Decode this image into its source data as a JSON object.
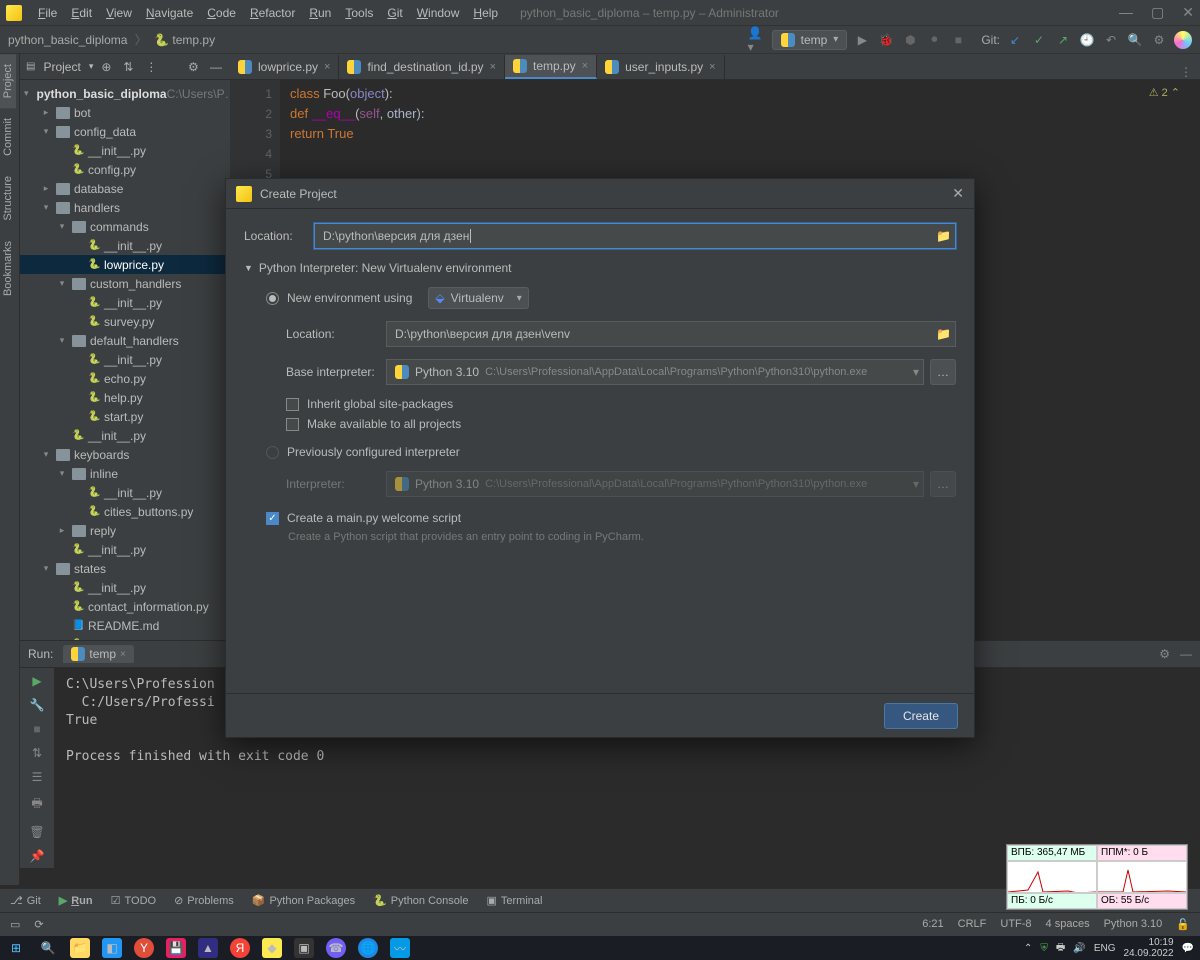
{
  "window": {
    "title": "python_basic_diploma – temp.py – Administrator",
    "menus": [
      "File",
      "Edit",
      "View",
      "Navigate",
      "Code",
      "Refactor",
      "Run",
      "Tools",
      "Git",
      "Window",
      "Help"
    ]
  },
  "breadcrumb": {
    "project": "python_basic_diploma",
    "file": "temp.py"
  },
  "run_config": {
    "name": "temp"
  },
  "toolbar": {
    "git_label": "Git:"
  },
  "left_tabs": [
    "Project",
    "Commit",
    "Structure",
    "Bookmarks"
  ],
  "project_panel": {
    "title": "Project"
  },
  "tree": {
    "root": "python_basic_diploma",
    "root_path": "C:\\Users\\P…",
    "nodes": [
      {
        "indent": 1,
        "type": "dir",
        "name": "bot",
        "arrow": ">"
      },
      {
        "indent": 1,
        "type": "dir",
        "name": "config_data",
        "arrow": "v"
      },
      {
        "indent": 2,
        "type": "py",
        "name": "__init__.py"
      },
      {
        "indent": 2,
        "type": "py",
        "name": "config.py"
      },
      {
        "indent": 1,
        "type": "dir",
        "name": "database",
        "arrow": ">"
      },
      {
        "indent": 1,
        "type": "dir",
        "name": "handlers",
        "arrow": "v"
      },
      {
        "indent": 2,
        "type": "dir",
        "name": "commands",
        "arrow": "v"
      },
      {
        "indent": 3,
        "type": "py",
        "name": "__init__.py"
      },
      {
        "indent": 3,
        "type": "py",
        "name": "lowprice.py",
        "selected": true
      },
      {
        "indent": 2,
        "type": "dir",
        "name": "custom_handlers",
        "arrow": "v"
      },
      {
        "indent": 3,
        "type": "py",
        "name": "__init__.py"
      },
      {
        "indent": 3,
        "type": "py",
        "name": "survey.py"
      },
      {
        "indent": 2,
        "type": "dir",
        "name": "default_handlers",
        "arrow": "v"
      },
      {
        "indent": 3,
        "type": "py",
        "name": "__init__.py"
      },
      {
        "indent": 3,
        "type": "py",
        "name": "echo.py"
      },
      {
        "indent": 3,
        "type": "py",
        "name": "help.py"
      },
      {
        "indent": 3,
        "type": "py",
        "name": "start.py"
      },
      {
        "indent": 2,
        "type": "py",
        "name": "__init__.py"
      },
      {
        "indent": 1,
        "type": "dir",
        "name": "keyboards",
        "arrow": "v"
      },
      {
        "indent": 2,
        "type": "dir",
        "name": "inline",
        "arrow": "v"
      },
      {
        "indent": 3,
        "type": "py",
        "name": "__init__.py"
      },
      {
        "indent": 3,
        "type": "py",
        "name": "cities_buttons.py"
      },
      {
        "indent": 2,
        "type": "dir",
        "name": "reply",
        "arrow": ">"
      },
      {
        "indent": 2,
        "type": "py",
        "name": "__init__.py"
      },
      {
        "indent": 1,
        "type": "dir",
        "name": "states",
        "arrow": "v"
      },
      {
        "indent": 2,
        "type": "py",
        "name": "__init__.py"
      },
      {
        "indent": 2,
        "type": "py",
        "name": "contact_information.py"
      },
      {
        "indent": 2,
        "type": "md",
        "name": "README.md"
      },
      {
        "indent": 2,
        "type": "py",
        "name": "user_inputs.py"
      }
    ]
  },
  "editor_tabs": [
    {
      "name": "lowprice.py"
    },
    {
      "name": "find_destination_id.py"
    },
    {
      "name": "temp.py",
      "active": true
    },
    {
      "name": "user_inputs.py"
    }
  ],
  "editor": {
    "lines": [
      "1",
      "2",
      "3",
      "4",
      "5"
    ],
    "problem_badge": "2 ⌃"
  },
  "code": {
    "l1a": "class ",
    "l1b": "Foo",
    "l1c": "(",
    "l1d": "object",
    "l1e": "):",
    "l2a": "    def ",
    "l2b": "__eq__",
    "l2c": "(",
    "l2d": "self",
    "l2e": ", other):",
    "l3a": "        return ",
    "l3b": "True"
  },
  "run_panel": {
    "title": "Run:",
    "tab": "temp",
    "output": "C:\\Users\\Profession\n  C:/Users/Professi\nTrue\n\nProcess finished with exit code 0"
  },
  "bottom_tabs": [
    "Git",
    "Run",
    "TODO",
    "Problems",
    "Python Packages",
    "Python Console",
    "Terminal"
  ],
  "status": {
    "pos": "6:21",
    "eol": "CRLF",
    "enc": "UTF-8",
    "indent": "4 spaces",
    "interp": "Python 3.10"
  },
  "dialog": {
    "title": "Create Project",
    "loc_label": "Location:",
    "loc_value": "D:\\python\\версия для дзен",
    "interp_section": "Python Interpreter: New Virtualenv environment",
    "new_env_label": "New environment using",
    "env_type": "Virtualenv",
    "venv_loc_label": "Location:",
    "venv_loc_value": "D:\\python\\версия для дзен\\venv",
    "base_label": "Base interpreter:",
    "base_value": "Python 3.10",
    "base_path": "C:\\Users\\Professional\\AppData\\Local\\Programs\\Python\\Python310\\python.exe",
    "inherit": "Inherit global site-packages",
    "makeavail": "Make available to all projects",
    "prev_conf": "Previously configured interpreter",
    "interp_label": "Interpreter:",
    "interp_value": "Python 3.10",
    "interp_path": "C:\\Users\\Professional\\AppData\\Local\\Programs\\Python\\Python310\\python.exe",
    "welcome": "Create a main.py welcome script",
    "welcome_hint": "Create a Python script that provides an entry point to coding in PyCharm.",
    "create_btn": "Create"
  },
  "resmon": {
    "tl": "ВПБ: 365,47 МБ",
    "tr": "ППМ*: 0 Б",
    "bl": "ПБ: 0 Б/с",
    "br": "ОБ: 55 Б/с"
  },
  "taskbar": {
    "lang": "ENG",
    "time": "10:19",
    "date": "24.09.2022"
  }
}
